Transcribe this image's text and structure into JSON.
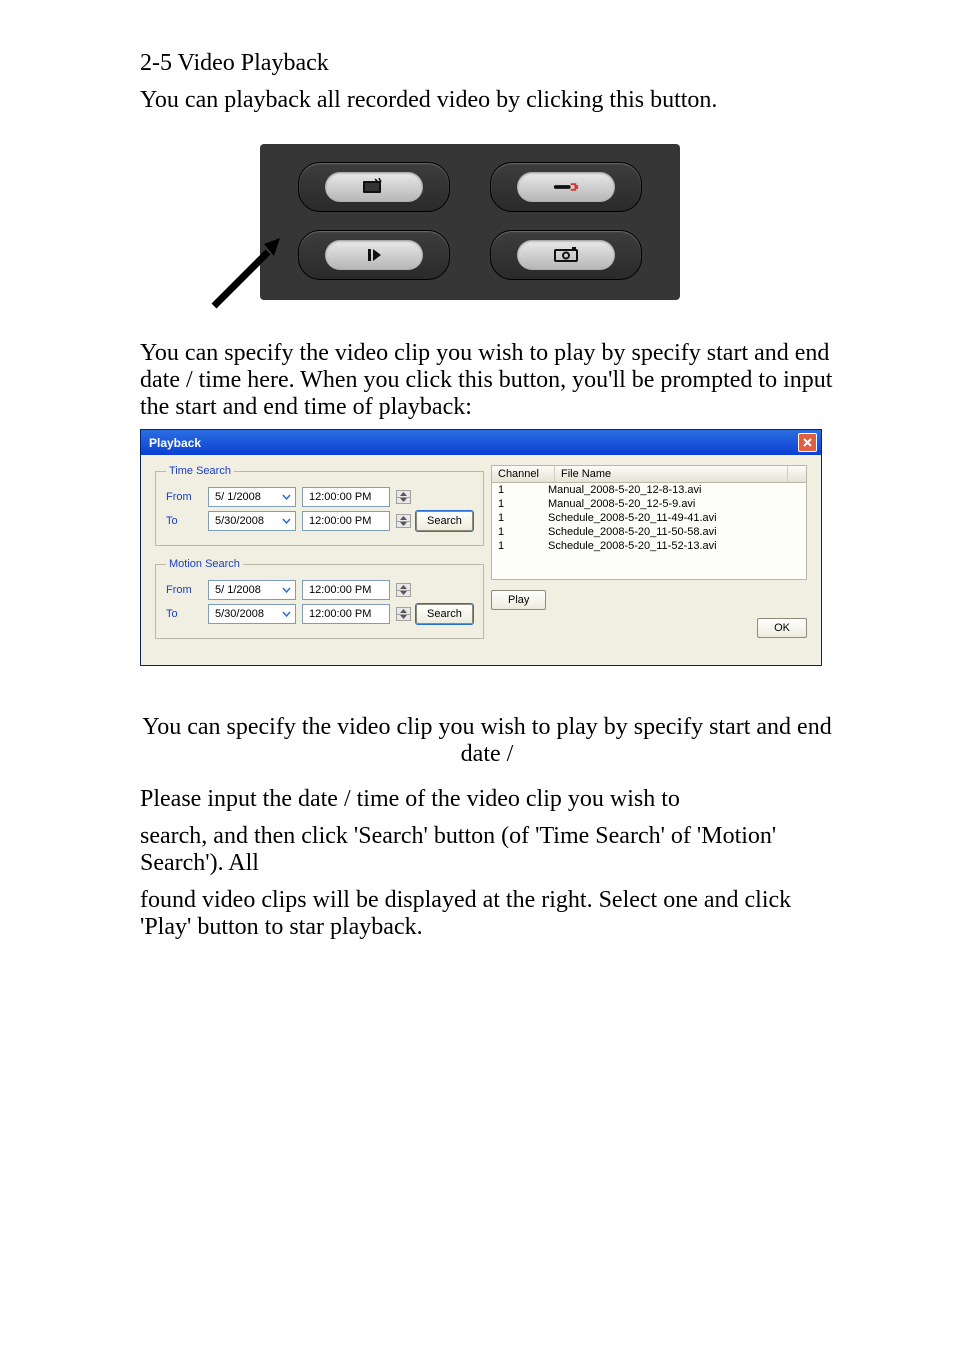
{
  "doc": {
    "section_title": "2-5 Video Playback",
    "intro": "You can playback all recorded video by clicking this button.",
    "middle_para": "You can specify the video clip you wish to play by specify start and end date / time here. When you click this button, you'll be prompted to input the start and end time of playback:",
    "search_para1_prefix": "Please input the date / time of the video clip you wish to ",
    "search_para1_suffix": "search, and then click 'Search' button (of 'Time Search' of 'Motion' Search'). All ",
    "search_para2": "found video clips will be displayed at the right. Select one and click 'Play' button to star playback."
  },
  "panel": {
    "alt": {
      "tv": "tv",
      "plug": "plug",
      "play": "play",
      "camera": "camera"
    }
  },
  "dialog": {
    "title": "Playback",
    "groups": {
      "time": {
        "legend": "Time Search"
      },
      "motion": {
        "legend": "Motion Search"
      }
    },
    "labels": {
      "from": "From",
      "to": "To"
    },
    "dates": {
      "from": "5/ 1/2008",
      "to": "5/30/2008"
    },
    "times": {
      "from": "12:00:00 PM",
      "to": "12:00:00 PM"
    },
    "buttons": {
      "search": "Search",
      "play": "Play",
      "ok": "OK"
    },
    "columns": {
      "channel": "Channel",
      "filename": "File Name"
    },
    "rows": [
      {
        "channel": "1",
        "file": "Manual_2008-5-20_12-8-13.avi"
      },
      {
        "channel": "1",
        "file": "Manual_2008-5-20_12-5-9.avi"
      },
      {
        "channel": "1",
        "file": "Schedule_2008-5-20_11-49-41.avi"
      },
      {
        "channel": "1",
        "file": "Schedule_2008-5-20_11-50-58.avi"
      },
      {
        "channel": "1",
        "file": "Schedule_2008-5-20_11-52-13.avi"
      }
    ]
  },
  "caption_prefix": "You can specify the video clip you wish to play by specify start and end date /"
}
